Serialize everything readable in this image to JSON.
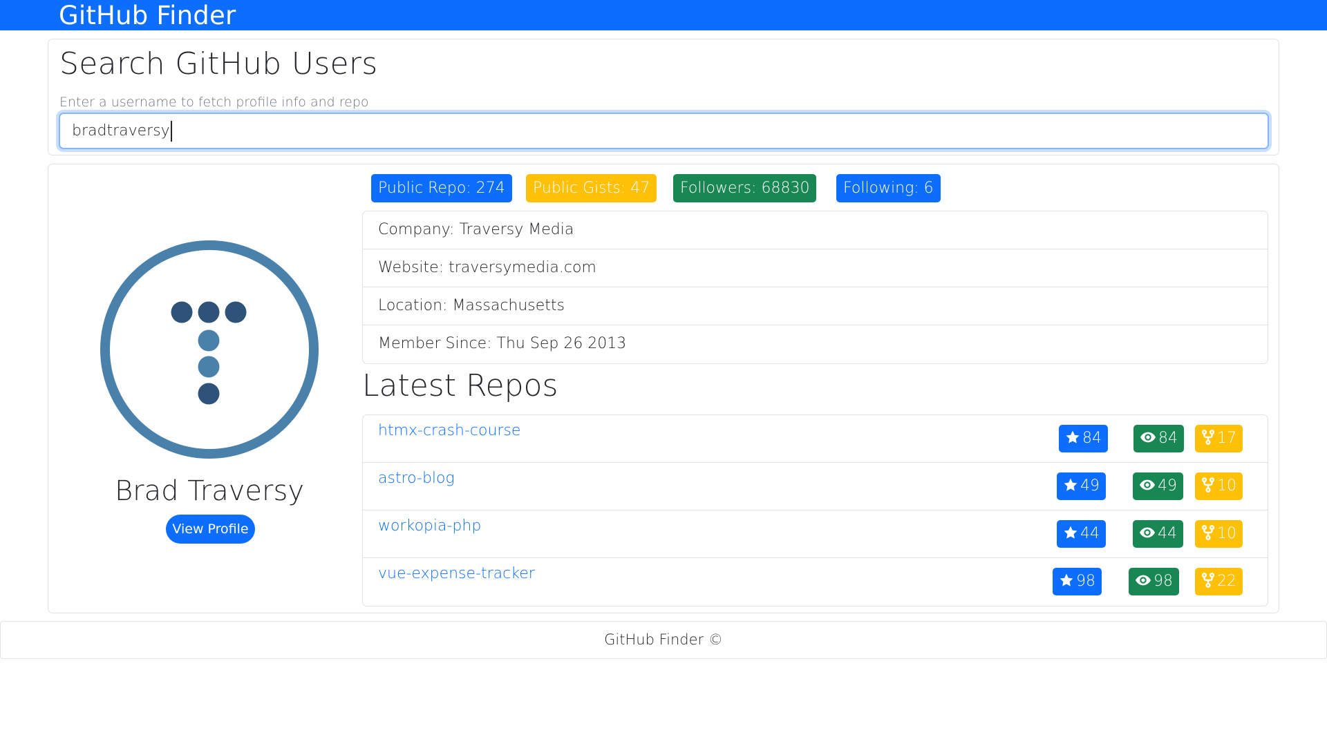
{
  "navbar": {
    "brand": "GitHub Finder"
  },
  "search": {
    "title": "Search GitHub Users",
    "hint": "Enter a username to fetch profile info and repo",
    "value": "bradtraversy"
  },
  "profile": {
    "name": "Brad Traversy",
    "view_profile_label": "View Profile",
    "avatar_colors": {
      "ring": "#4a81ab",
      "dot_dark": "#2e5278",
      "dot_light": "#4a81ab"
    },
    "badges": [
      {
        "label": "Public Repo: 274",
        "color": "#0d6efd"
      },
      {
        "label": "Public Gists: 47",
        "color": "#ffc107"
      },
      {
        "label": "Followers: 68830",
        "color": "#198754"
      },
      {
        "label": "Following: 6",
        "color": "#0d6efd"
      }
    ],
    "info": [
      "Company: Traversy Media",
      "Website: traversymedia.com",
      "Location: Massachusetts",
      "Member Since: Thu Sep 26 2013"
    ]
  },
  "repos": {
    "title": "Latest Repos",
    "items": [
      {
        "name": "htmx-crash-course",
        "stars": "84",
        "watchers": "84",
        "forks": "17"
      },
      {
        "name": "astro-blog",
        "stars": "49",
        "watchers": "49",
        "forks": "10"
      },
      {
        "name": "workopia-php",
        "stars": "44",
        "watchers": "44",
        "forks": "10"
      },
      {
        "name": "vue-expense-tracker",
        "stars": "98",
        "watchers": "98",
        "forks": "22"
      }
    ],
    "icons": {
      "stars": "star-icon",
      "watchers": "eye-icon",
      "forks": "fork-icon"
    }
  },
  "footer": {
    "text": "GitHub Finder ©"
  },
  "colors": {
    "primary": "#0d6efd",
    "warning": "#ffc107",
    "success": "#198754",
    "border": "#dee2e6"
  }
}
